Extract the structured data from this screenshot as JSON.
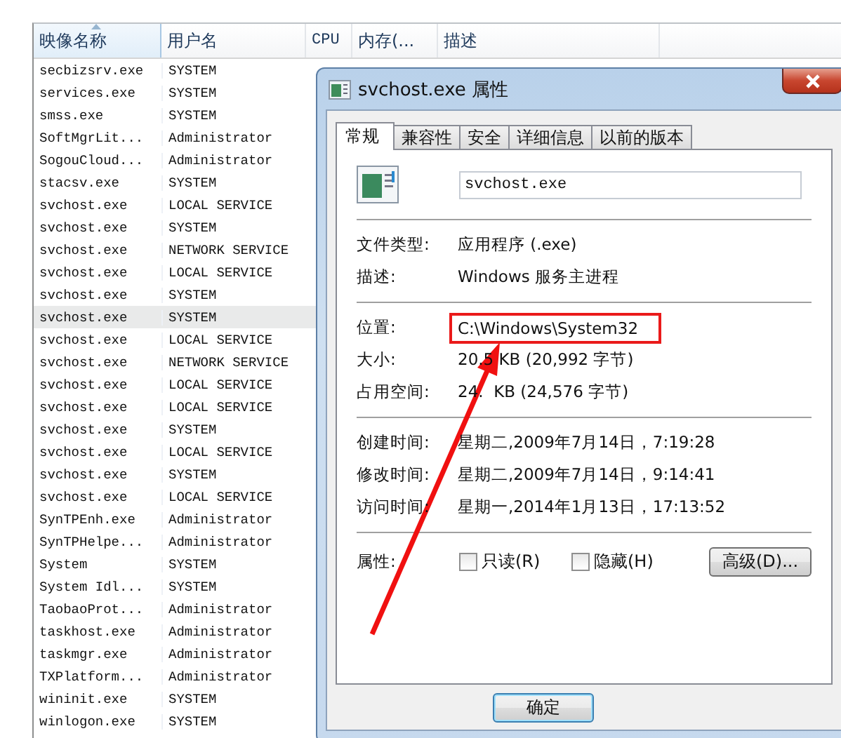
{
  "task_list": {
    "columns": [
      {
        "label": "映像名称",
        "sorted": true
      },
      {
        "label": "用户名",
        "sorted": false
      },
      {
        "label": "CPU",
        "sorted": false
      },
      {
        "label": "内存(...",
        "sorted": false
      },
      {
        "label": "描述",
        "sorted": false
      }
    ],
    "rows": [
      {
        "image": "secbizsrv.exe",
        "user": "SYSTEM",
        "selected": false
      },
      {
        "image": "services.exe",
        "user": "SYSTEM",
        "selected": false
      },
      {
        "image": "smss.exe",
        "user": "SYSTEM",
        "selected": false
      },
      {
        "image": "SoftMgrLit...",
        "user": "Administrator",
        "selected": false
      },
      {
        "image": "SogouCloud...",
        "user": "Administrator",
        "selected": false
      },
      {
        "image": "stacsv.exe",
        "user": "SYSTEM",
        "selected": false
      },
      {
        "image": "svchost.exe",
        "user": "LOCAL SERVICE",
        "selected": false
      },
      {
        "image": "svchost.exe",
        "user": "SYSTEM",
        "selected": false
      },
      {
        "image": "svchost.exe",
        "user": "NETWORK SERVICE",
        "selected": false
      },
      {
        "image": "svchost.exe",
        "user": "LOCAL SERVICE",
        "selected": false
      },
      {
        "image": "svchost.exe",
        "user": "SYSTEM",
        "selected": false
      },
      {
        "image": "svchost.exe",
        "user": "SYSTEM",
        "selected": true
      },
      {
        "image": "svchost.exe",
        "user": "LOCAL SERVICE",
        "selected": false
      },
      {
        "image": "svchost.exe",
        "user": "NETWORK SERVICE",
        "selected": false
      },
      {
        "image": "svchost.exe",
        "user": "LOCAL SERVICE",
        "selected": false
      },
      {
        "image": "svchost.exe",
        "user": "LOCAL SERVICE",
        "selected": false
      },
      {
        "image": "svchost.exe",
        "user": "SYSTEM",
        "selected": false
      },
      {
        "image": "svchost.exe",
        "user": "LOCAL SERVICE",
        "selected": false
      },
      {
        "image": "svchost.exe",
        "user": "SYSTEM",
        "selected": false
      },
      {
        "image": "svchost.exe",
        "user": "LOCAL SERVICE",
        "selected": false
      },
      {
        "image": "SynTPEnh.exe",
        "user": "Administrator",
        "selected": false
      },
      {
        "image": "SynTPHelpe...",
        "user": "Administrator",
        "selected": false
      },
      {
        "image": "System",
        "user": "SYSTEM",
        "selected": false
      },
      {
        "image": "System Idl...",
        "user": "SYSTEM",
        "selected": false
      },
      {
        "image": "TaobaoProt...",
        "user": "Administrator",
        "selected": false
      },
      {
        "image": "taskhost.exe",
        "user": "Administrator",
        "selected": false
      },
      {
        "image": "taskmgr.exe",
        "user": "Administrator",
        "selected": false
      },
      {
        "image": "TXPlatform...",
        "user": "Administrator",
        "selected": false
      },
      {
        "image": "wininit.exe",
        "user": "SYSTEM",
        "selected": false
      },
      {
        "image": "winlogon.exe",
        "user": "SYSTEM",
        "selected": false
      }
    ]
  },
  "dialog": {
    "title": "svchost.exe 属性",
    "tabs": [
      {
        "label": "常规",
        "selected": true
      },
      {
        "label": "兼容性",
        "selected": false
      },
      {
        "label": "安全",
        "selected": false
      },
      {
        "label": "详细信息",
        "selected": false
      },
      {
        "label": "以前的版本",
        "selected": false
      }
    ],
    "file_name": "svchost.exe",
    "groups": [
      [
        {
          "label": "文件类型:",
          "value": "应用程序 (.exe)",
          "highlighted": false
        },
        {
          "label": "描述:",
          "value": "Windows 服务主进程",
          "highlighted": false
        }
      ],
      [
        {
          "label": "位置:",
          "value": "C:\\Windows\\System32",
          "highlighted": true
        },
        {
          "label": "大小:",
          "value": "20.5 KB (20,992 字节)",
          "highlighted": false
        },
        {
          "label": "占用空间:",
          "value": "24.  KB (24,576 字节)",
          "highlighted": false
        }
      ],
      [
        {
          "label": "创建时间:",
          "value": "星期二,2009年7月14日，7:19:28",
          "highlighted": false
        },
        {
          "label": "修改时间:",
          "value": "星期二,2009年7月14日，9:14:41",
          "highlighted": false
        },
        {
          "label": "访问时间:",
          "value": "星期一,2014年1月13日，17:13:52",
          "highlighted": false
        }
      ]
    ],
    "attributes_label": "属性:",
    "checkboxes": [
      {
        "label": "只读(R)",
        "checked": false
      },
      {
        "label": "隐藏(H)",
        "checked": false
      }
    ],
    "advanced_button": "高级(D)...",
    "buttons": [
      "确定"
    ]
  }
}
